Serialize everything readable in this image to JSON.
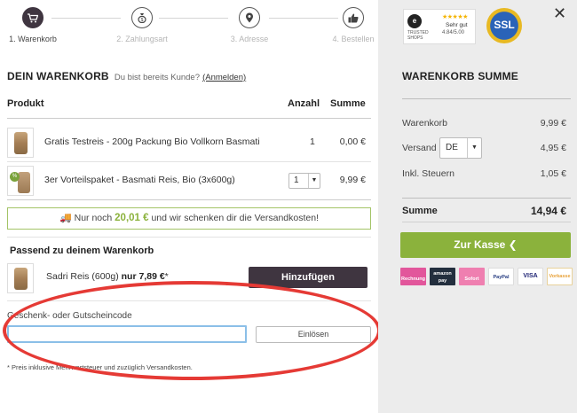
{
  "steps": [
    {
      "label": "1. Warenkorb",
      "icon": "cart-icon",
      "active": true
    },
    {
      "label": "2. Zahlungsart",
      "icon": "money-bag-icon",
      "active": false
    },
    {
      "label": "3. Adresse",
      "icon": "location-pin-icon",
      "active": false
    },
    {
      "label": "4. Bestellen",
      "icon": "thumbs-up-icon",
      "active": false
    }
  ],
  "cart": {
    "title": "DEIN WARENKORB",
    "subtitle": "Du bist bereits Kunde?",
    "login_link": "(Anmelden)",
    "col_product": "Produkt",
    "col_qty": "Anzahl",
    "col_sum": "Summe",
    "items": [
      {
        "name": "Gratis Testreis - 200g Packung Bio Vollkorn Basmati",
        "qty": "1",
        "sum": "0,00 €"
      },
      {
        "name": "3er Vorteilspaket - Basmati Reis, Bio (3x600g)",
        "qty": "1",
        "sum": "9,99 €"
      }
    ],
    "shipping_promo": {
      "prefix": "Nur noch",
      "amount": "20,01 €",
      "suffix": "und wir schenken dir die Versandkosten!"
    }
  },
  "upsell": {
    "title": "Passend zu deinem Warenkorb",
    "product": "Sadri Reis (600g)",
    "price_prefix": "nur",
    "price": "7,89 €",
    "asterisk": "*",
    "button": "Hinzufügen"
  },
  "voucher": {
    "label": "Geschenk- oder Gutscheincode",
    "value": "",
    "placeholder": "",
    "button": "Einlösen"
  },
  "footnote": "* Preis inklusive Mehrwertsteuer und zuzüglich Versandkosten.",
  "summary": {
    "title": "WARENKORB SUMME",
    "subtotal_label": "Warenkorb",
    "subtotal": "9,99 €",
    "shipping_label": "Versand",
    "shipping_country": "DE",
    "shipping": "4,95 €",
    "tax_label": "Inkl. Steuern",
    "tax": "1,05 €",
    "total_label": "Summe",
    "total": "14,94 €",
    "checkout_button": "Zur Kasse ❮"
  },
  "badges": {
    "trusted_top": "TRUSTED",
    "trusted_bottom": "SHOPS",
    "rating_text": "Sehr gut",
    "rating": "4.84/5.00",
    "ssl": "SSL"
  },
  "payments": [
    "Rechnung",
    "amazon pay",
    "Sofort",
    "PayPal",
    "VISA",
    "Vorkasse"
  ],
  "colors": {
    "accent": "#8bb23c",
    "dark": "#3f3540",
    "highlight": "#e53a35"
  }
}
